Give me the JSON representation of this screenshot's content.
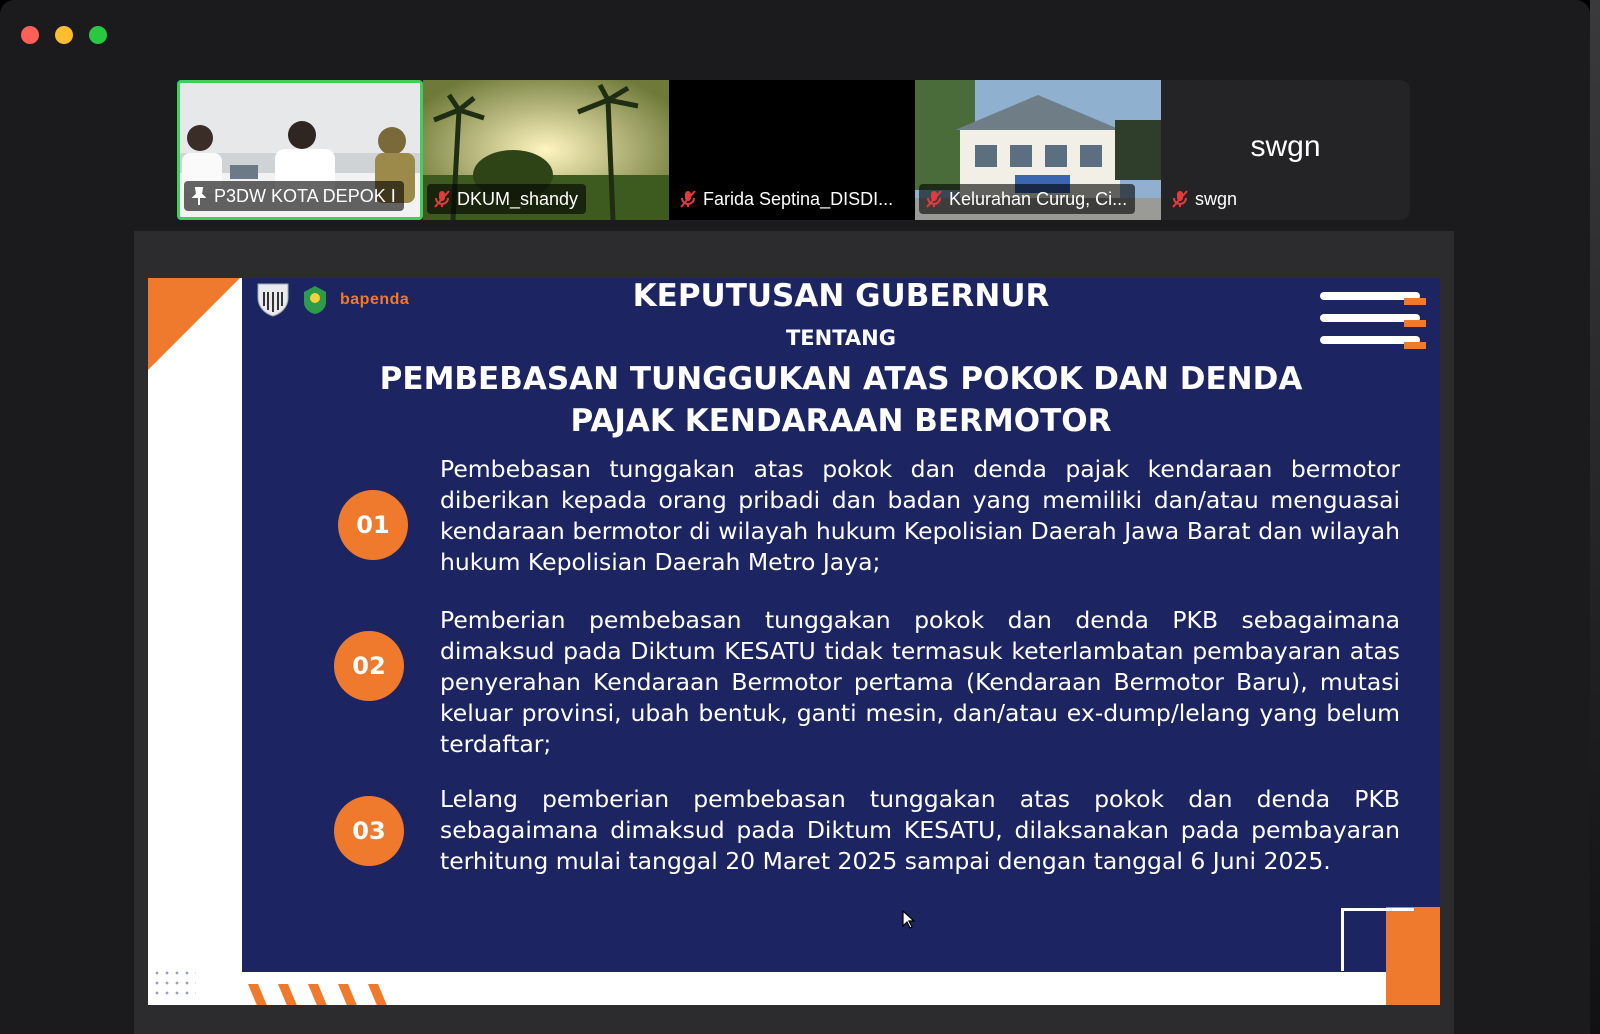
{
  "participants": [
    {
      "name": "P3DW KOTA DEPOK I",
      "status": "pinned",
      "active": true
    },
    {
      "name": "DKUM_shandy",
      "status": "muted"
    },
    {
      "name": "Farida Septina_DISDI...",
      "status": "muted"
    },
    {
      "name": "Kelurahan Curug, Ci...",
      "status": "muted"
    },
    {
      "name": "swgn",
      "status": "muted",
      "display_name": "swgn"
    }
  ],
  "slide": {
    "logo_text": "bapenda",
    "title": "KEPUTUSAN GUBERNUR",
    "subtitle": "TENTANG",
    "heading_line1": "PEMBEBASAN TUNGGUKAN ATAS POKOK DAN DENDA",
    "heading_line2": "PAJAK KENDARAAN BERMOTOR",
    "items": [
      {
        "number": "01",
        "text": "Pembebasan tunggakan atas pokok dan denda pajak kendaraan bermotor diberikan kepada orang pribadi dan badan yang memiliki dan/atau menguasai kendaraan bermotor di wilayah hukum Kepolisian Daerah Jawa Barat dan wilayah hukum Kepolisian Daerah Metro Jaya;"
      },
      {
        "number": "02",
        "text": "Pemberian pembebasan tunggakan pokok dan denda PKB sebagaimana dimaksud pada Diktum KESATU tidak termasuk keterlambatan pembayaran atas penyerahan Kendaraan Bermotor pertama (Kendaraan Bermotor Baru), mutasi keluar provinsi, ubah bentuk, ganti mesin, dan/atau ex-dump/lelang yang belum terdaftar;"
      },
      {
        "number": "03",
        "text": "Lelang pemberian pembebasan tunggakan atas pokok dan denda PKB sebagaimana dimaksud pada Diktum KESATU, dilaksanakan pada pembayaran terhitung mulai tanggal 20 Maret 2025 sampai dengan tanggal 6 Juni 2025."
      }
    ]
  },
  "colors": {
    "accent_orange": "#ef7a2d",
    "slide_navy": "#1c2461",
    "active_speaker": "#3ed05a"
  }
}
